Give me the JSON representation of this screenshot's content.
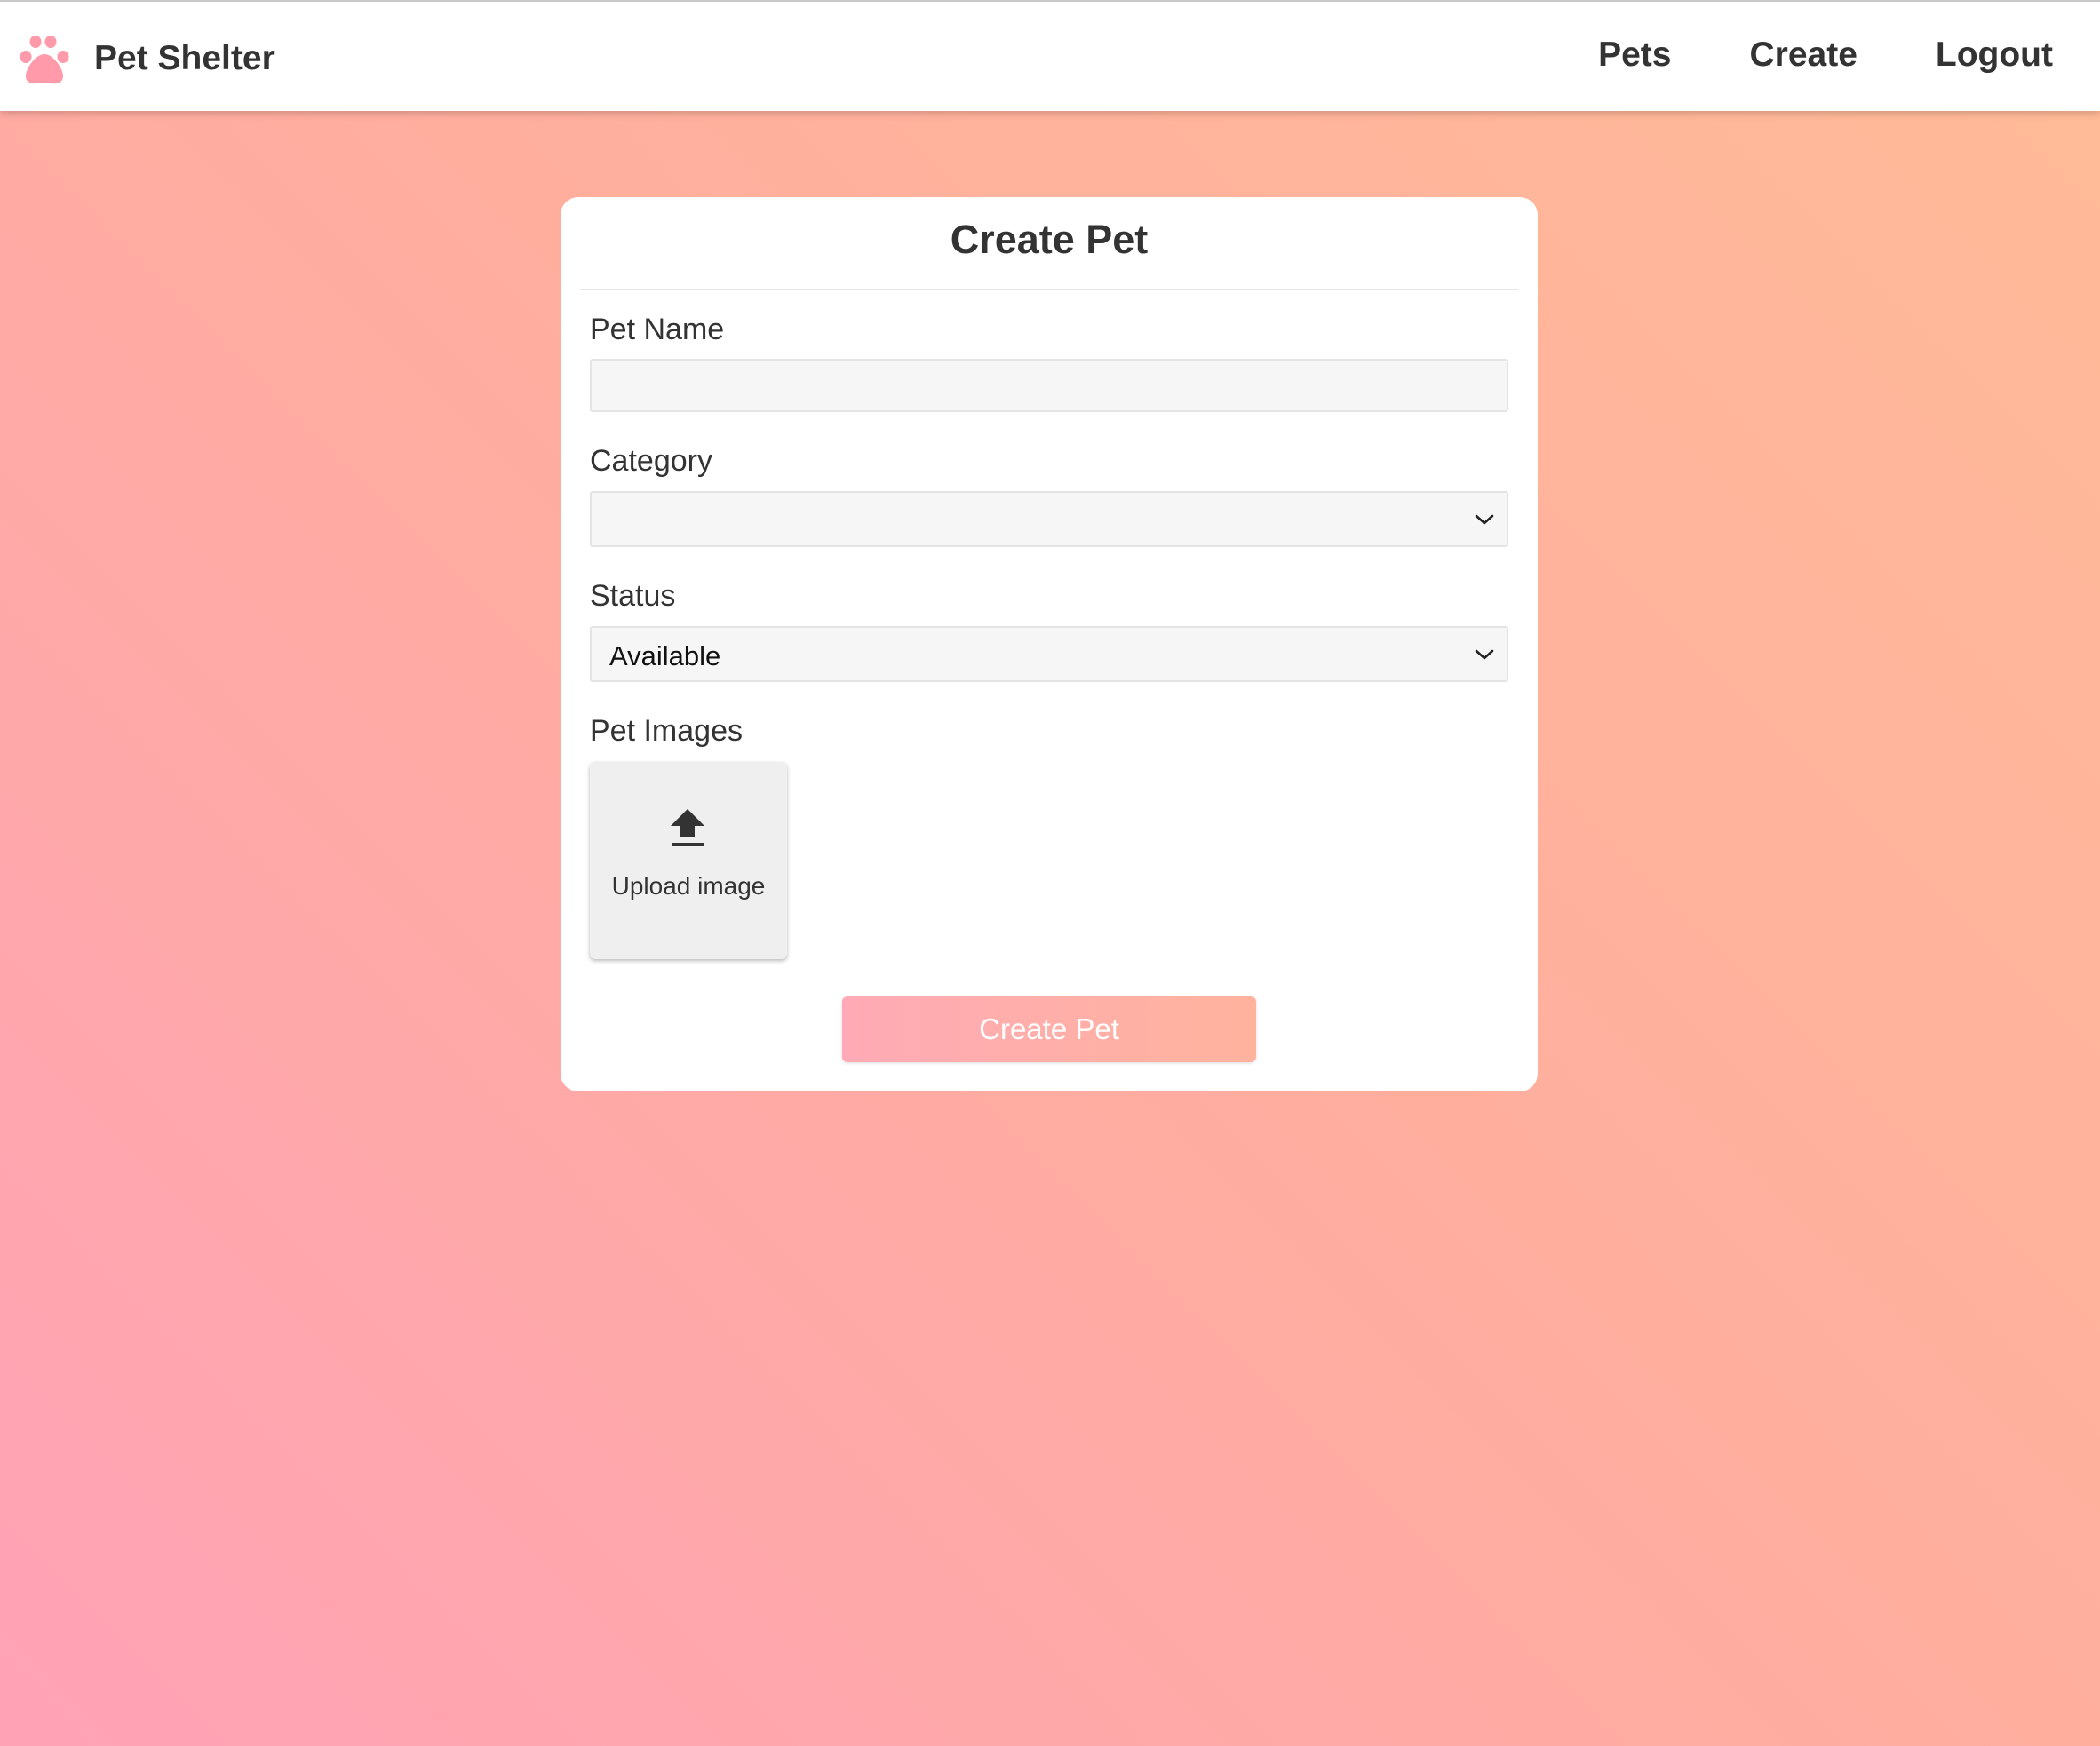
{
  "navbar": {
    "brand_icon": "paw-icon",
    "brand_name": "Pet Shelter",
    "links": [
      {
        "label": "Pets"
      },
      {
        "label": "Create"
      },
      {
        "label": "Logout"
      }
    ]
  },
  "form": {
    "title": "Create Pet",
    "pet_name": {
      "label": "Pet Name",
      "value": ""
    },
    "category": {
      "label": "Category",
      "value": ""
    },
    "status": {
      "label": "Status",
      "value": "Available"
    },
    "images": {
      "label": "Pet Images",
      "upload_icon": "upload-icon",
      "upload_label": "Upload image"
    },
    "submit_label": "Create Pet"
  },
  "colors": {
    "background_start": "#ffa2b6",
    "background_end": "#ffbb97",
    "brand_pink": "#ff9aaa",
    "button_start": "#ffaab6",
    "button_end": "#ffb39d",
    "text_dark": "#333333"
  }
}
